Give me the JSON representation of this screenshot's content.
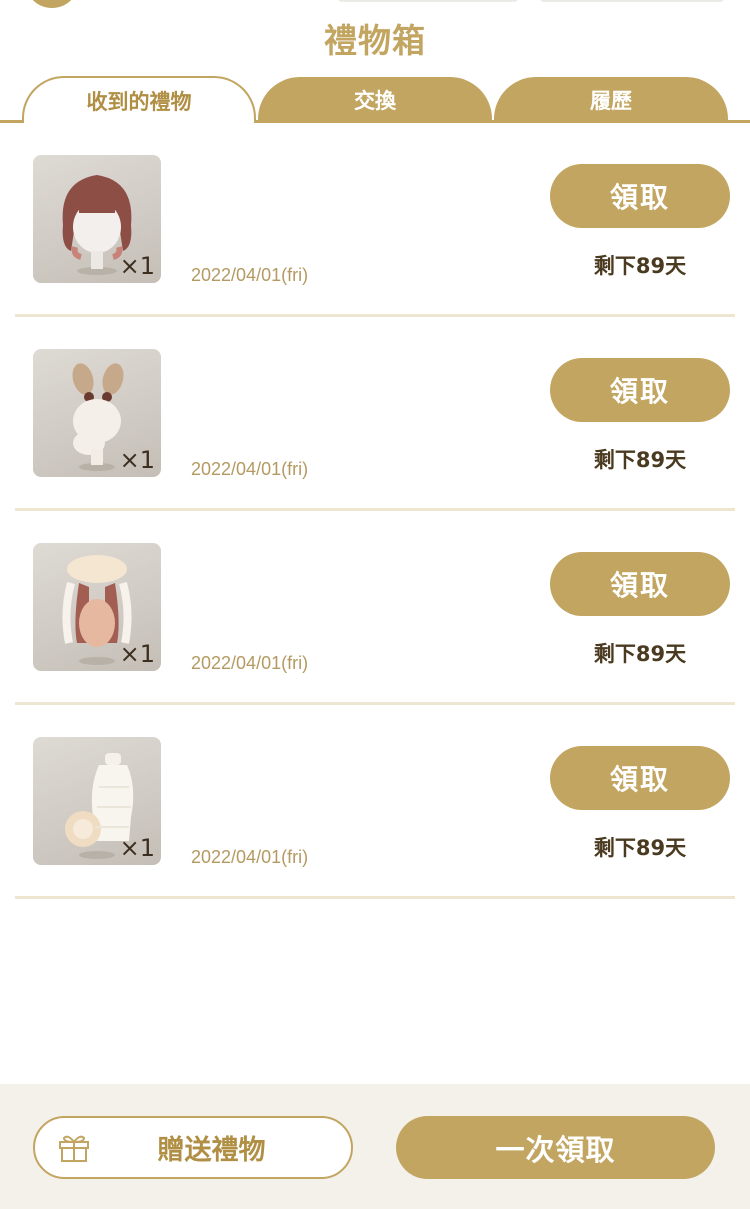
{
  "header": {
    "title": "禮物箱"
  },
  "tabs": [
    {
      "label": "收到的禮物",
      "active": true
    },
    {
      "label": "交換",
      "active": false
    },
    {
      "label": "履歷",
      "active": false
    }
  ],
  "gifts": [
    {
      "image": "hair-brown-bob",
      "quantity": "×1",
      "date": "2022/04/01(fri)",
      "claim_label": "領取",
      "remaining": "剩下89天"
    },
    {
      "image": "bunny-ears-accessory",
      "quantity": "×1",
      "date": "2022/04/01(fri)",
      "claim_label": "領取",
      "remaining": "剩下89天"
    },
    {
      "image": "hair-cream-long-bun",
      "quantity": "×1",
      "date": "2022/04/01(fri)",
      "claim_label": "領取",
      "remaining": "剩下89天"
    },
    {
      "image": "knit-outfit-cream",
      "quantity": "×1",
      "date": "2022/04/01(fri)",
      "claim_label": "領取",
      "remaining": "剩下89天"
    }
  ],
  "footer": {
    "send_label": "贈送禮物",
    "claim_all_label": "一次領取",
    "send_icon": "gift-icon"
  },
  "colors": {
    "accent": "#c2a561",
    "accent_text": "#b08f45",
    "footer_bg": "#f4f0ea",
    "divider": "#efe6d2"
  }
}
